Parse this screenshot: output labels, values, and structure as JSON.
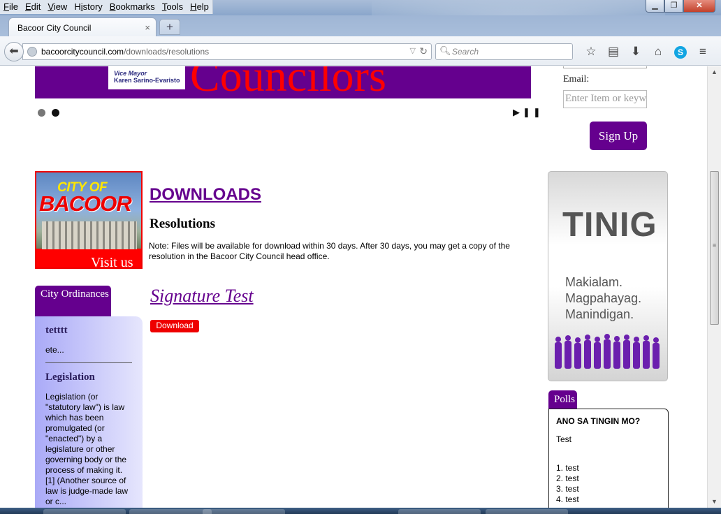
{
  "menu": [
    {
      "key": "F",
      "rest": "ile"
    },
    {
      "key": "E",
      "rest": "dit"
    },
    {
      "key": "V",
      "rest": "iew"
    },
    {
      "key": "Hi",
      "rest": "story",
      "u_index": 1
    },
    {
      "key": "B",
      "rest": "ookmarks"
    },
    {
      "key": "T",
      "rest": "ools"
    },
    {
      "key": "H",
      "rest": "elp"
    }
  ],
  "menu_labels": [
    "File",
    "Edit",
    "View",
    "History",
    "Bookmarks",
    "Tools",
    "Help"
  ],
  "tab": {
    "title": "Bacoor City Council",
    "close": "×",
    "new": "+"
  },
  "url": {
    "host": "bacoorcitycouncil.com",
    "path": "/downloads/resolutions"
  },
  "search": {
    "placeholder": "Search"
  },
  "banner": {
    "role": "Vice Mayor",
    "name": "Karen Sarino-Evaristo",
    "word": "Councilors"
  },
  "newsletter": {
    "email_label": "Email:",
    "email_placeholder": "Enter Item or keyw",
    "signup": "Sign Up"
  },
  "visit": {
    "city_of": "CITY OF",
    "bacoor": "BACOOR",
    "cta": "Visit us"
  },
  "downloads": {
    "title": "DOWNLOADS",
    "subtitle": "Resolutions",
    "note": "Note: Files will be available for download within 30 days. After 30 days, you may get a copy of the resolution in the Bacoor City Council head office.",
    "file_title": "Signature Test",
    "download_label": "Download"
  },
  "ordinances": {
    "tab": "City Ordinances",
    "items": [
      {
        "title": "tetttt",
        "text": "ete..."
      },
      {
        "title": "Legislation",
        "text": "Legislation (or \"statutory law\") is law which has been promulgated (or \"enacted\") by a legislature or other governing body or the process of making it.[1] (Another source of law is judge-made law or c..."
      }
    ]
  },
  "tinig": {
    "title": "TINIG",
    "lines": [
      "Makialam.",
      "Magpahayag.",
      "Manindigan."
    ]
  },
  "polls": {
    "tab": "Polls",
    "question": "ANO SA TINGIN MO?",
    "topic": "Test",
    "options": [
      "1. test",
      "2. test",
      "3. test",
      "4. test"
    ]
  },
  "colors": {
    "brand_purple": "#65008e",
    "accent_red": "#ff0000"
  }
}
